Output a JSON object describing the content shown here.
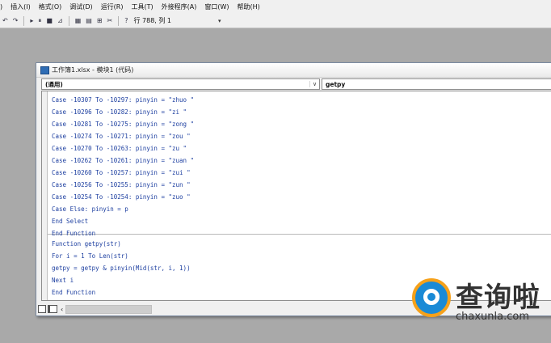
{
  "menu": [
    "插入(I)",
    "格式(O)",
    "调试(D)",
    "运行(R)",
    "工具(T)",
    "外接程序(A)",
    "窗口(W)",
    "帮助(H)"
  ],
  "menu_lead": ")",
  "toolbar": {
    "icons": [
      "undo-icon",
      "redo-icon",
      "run-icon",
      "break-icon",
      "reset-icon",
      "design-mode-icon",
      "project-explorer-icon",
      "properties-icon",
      "object-browser-icon",
      "toolbox-icon",
      "help-icon"
    ],
    "position": "行 788, 列 1"
  },
  "window": {
    "title": "工作簿1.xlsx - 模块1 (代码)",
    "object_combo": "(通用)",
    "procedure_combo": "getpy"
  },
  "code_lines": [
    "Case -10307 To -10297: pinyin = \"zhuo \"",
    "Case -10296 To -10282: pinyin = \"zi \"",
    "Case -10281 To -10275: pinyin = \"zong \"",
    "Case -10274 To -10271: pinyin = \"zou \"",
    "Case -10270 To -10263: pinyin = \"zu \"",
    "Case -10262 To -10261: pinyin = \"zuan \"",
    "Case -10260 To -10257: pinyin = \"zui \"",
    "Case -10256 To -10255: pinyin = \"zun \"",
    "Case -10254 To -10254: pinyin = \"zuo \"",
    "Case Else: pinyin = p",
    "End Select",
    "End Function",
    "Function getpy(str)",
    "For i = 1 To Len(str)",
    "getpy = getpy & pinyin(Mid(str, i, 1))",
    "Next i",
    "End Function"
  ],
  "watermark": {
    "text": "查询啦",
    "domain": "chaxunla.com",
    "colors": {
      "blue": "#1a8ad6",
      "orange": "#f6a11a"
    }
  }
}
